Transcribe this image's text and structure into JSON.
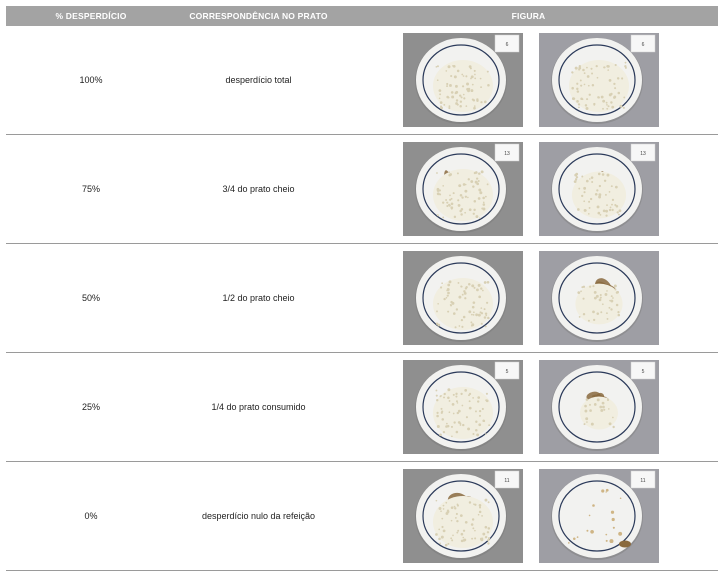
{
  "table": {
    "headers": {
      "waste": "% DESPERDÍCIO",
      "correspondence": "CORRESPONDÊNCIA NO PRATO",
      "figure": "FIGURA"
    },
    "rows": [
      {
        "percent": "100%",
        "description": "desperdício total",
        "photo_labels": [
          "6",
          "6"
        ],
        "rice_level": 1.0
      },
      {
        "percent": "75%",
        "description": "3/4 do prato cheio",
        "photo_labels": [
          "13",
          "13"
        ],
        "rice_level": 0.75
      },
      {
        "percent": "50%",
        "description": "1/2 do prato cheio",
        "photo_labels": [
          "",
          ""
        ],
        "rice_level": 0.5
      },
      {
        "percent": "25%",
        "description": "1/4 do prato consumido",
        "photo_labels": [
          "5",
          "5"
        ],
        "rice_level": 0.25
      },
      {
        "percent": "0%",
        "description": "desperdício nulo da refeição",
        "photo_labels": [
          "11",
          "11"
        ],
        "rice_level": 0.0
      }
    ]
  },
  "colors": {
    "header_bg": "#a3a3a3",
    "tray": "#8f8f8f",
    "plate": "#f2f2f0",
    "plate_rim": "#2b3a5a",
    "rice": "#f1eee0",
    "meat": "#8a6a3e"
  }
}
